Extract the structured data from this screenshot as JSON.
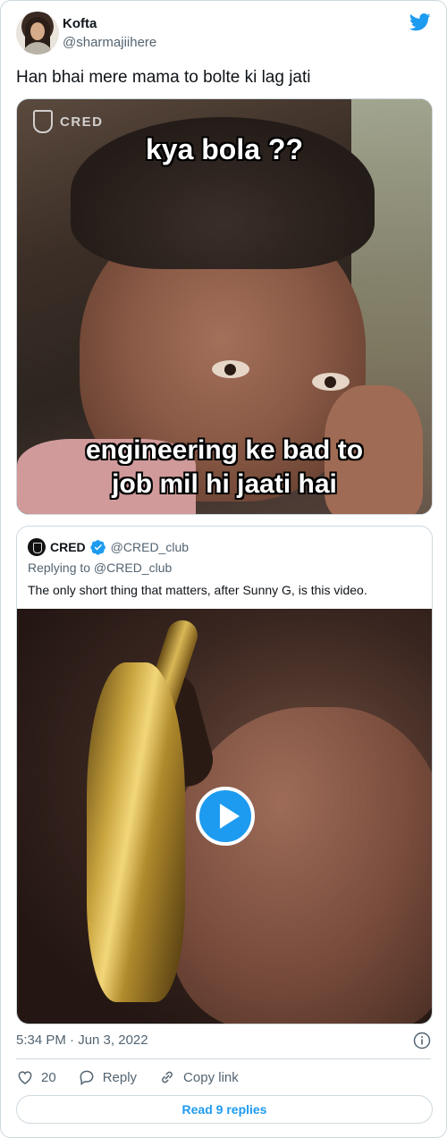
{
  "author": {
    "name": "Kofta",
    "handle": "@sharmajiihere"
  },
  "tweet": {
    "text": "Han bhai mere mama to bolte ki lag jati"
  },
  "media": {
    "watermark": "CRED",
    "top_caption": "kya bola ??",
    "bottom_caption_line1": "engineering ke bad to",
    "bottom_caption_line2": "job mil hi jaati hai"
  },
  "quoted": {
    "name": "CRED",
    "handle": "@CRED_club",
    "replying": "Replying to @CRED_club",
    "text": "The only short thing that matters, after Sunny G, is this video."
  },
  "footer": {
    "timestamp": "5:34 PM · Jun 3, 2022",
    "likes": "20",
    "reply_label": "Reply",
    "copy_link_label": "Copy link",
    "read_replies": "Read 9 replies"
  },
  "colors": {
    "accent": "#1d9bf0",
    "muted": "#536471",
    "border": "#cfd9de"
  }
}
